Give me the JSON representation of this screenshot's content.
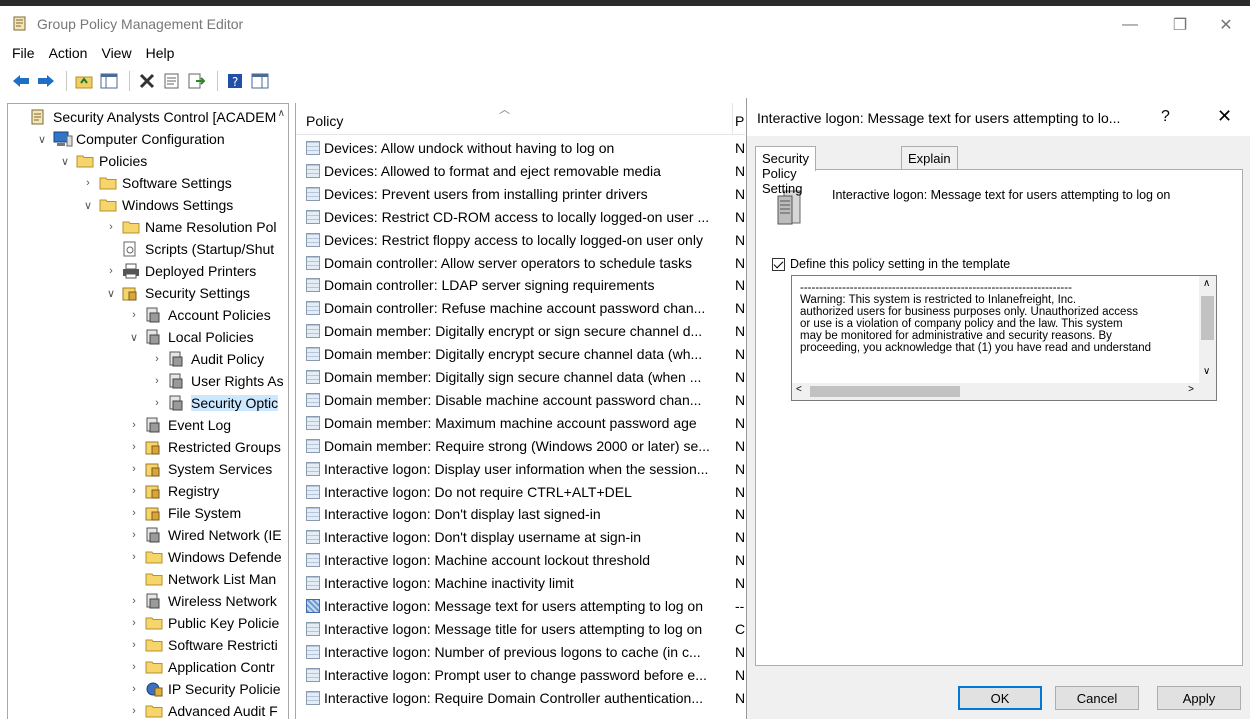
{
  "window": {
    "title": "Group Policy Management Editor"
  },
  "menu": [
    "File",
    "Action",
    "View",
    "Help"
  ],
  "tree": [
    {
      "label": "Security Analysts Control [ACADEM",
      "indent": 0,
      "chev": "",
      "icon": "gpo"
    },
    {
      "label": "Computer Configuration",
      "indent": 1,
      "chev": "v",
      "icon": "computer"
    },
    {
      "label": "Policies",
      "indent": 2,
      "chev": "v",
      "icon": "folder"
    },
    {
      "label": "Software Settings",
      "indent": 3,
      "chev": ">",
      "icon": "folder"
    },
    {
      "label": "Windows Settings",
      "indent": 3,
      "chev": "v",
      "icon": "folder"
    },
    {
      "label": "Name Resolution Pol",
      "indent": 4,
      "chev": ">",
      "icon": "folder"
    },
    {
      "label": "Scripts (Startup/Shut",
      "indent": 4,
      "chev": "",
      "icon": "script"
    },
    {
      "label": "Deployed Printers",
      "indent": 4,
      "chev": ">",
      "icon": "printer"
    },
    {
      "label": "Security Settings",
      "indent": 4,
      "chev": "v",
      "icon": "shield"
    },
    {
      "label": "Account Policies",
      "indent": 5,
      "chev": ">",
      "icon": "gear"
    },
    {
      "label": "Local Policies",
      "indent": 5,
      "chev": "v",
      "icon": "gear"
    },
    {
      "label": "Audit Policy",
      "indent": 6,
      "chev": ">",
      "icon": "gear"
    },
    {
      "label": "User Rights As",
      "indent": 6,
      "chev": ">",
      "icon": "gear"
    },
    {
      "label": "Security Optic",
      "indent": 6,
      "chev": ">",
      "icon": "gear",
      "selected": true
    },
    {
      "label": "Event Log",
      "indent": 5,
      "chev": ">",
      "icon": "gear"
    },
    {
      "label": "Restricted Groups",
      "indent": 5,
      "chev": ">",
      "icon": "shield"
    },
    {
      "label": "System Services",
      "indent": 5,
      "chev": ">",
      "icon": "shield"
    },
    {
      "label": "Registry",
      "indent": 5,
      "chev": ">",
      "icon": "shield"
    },
    {
      "label": "File System",
      "indent": 5,
      "chev": ">",
      "icon": "shield"
    },
    {
      "label": "Wired Network (IE",
      "indent": 5,
      "chev": ">",
      "icon": "gear"
    },
    {
      "label": "Windows Defende",
      "indent": 5,
      "chev": ">",
      "icon": "folder"
    },
    {
      "label": "Network List Man",
      "indent": 5,
      "chev": "",
      "icon": "folder"
    },
    {
      "label": "Wireless Network",
      "indent": 5,
      "chev": ">",
      "icon": "gear"
    },
    {
      "label": "Public Key Policie",
      "indent": 5,
      "chev": ">",
      "icon": "folder"
    },
    {
      "label": "Software Restricti",
      "indent": 5,
      "chev": ">",
      "icon": "folder"
    },
    {
      "label": "Application Contr",
      "indent": 5,
      "chev": ">",
      "icon": "folder"
    },
    {
      "label": "IP Security Policie",
      "indent": 5,
      "chev": ">",
      "icon": "ipsec"
    },
    {
      "label": "Advanced Audit F",
      "indent": 5,
      "chev": ">",
      "icon": "folder"
    }
  ],
  "list": {
    "header_policy": "Policy",
    "header_setting": "P",
    "rows": [
      {
        "name": "Devices: Allow undock without having to log on",
        "value": "N"
      },
      {
        "name": "Devices: Allowed to format and eject removable media",
        "value": "N"
      },
      {
        "name": "Devices: Prevent users from installing printer drivers",
        "value": "N"
      },
      {
        "name": "Devices: Restrict CD-ROM access to locally logged-on user ...",
        "value": "N"
      },
      {
        "name": "Devices: Restrict floppy access to locally logged-on user only",
        "value": "N"
      },
      {
        "name": "Domain controller: Allow server operators to schedule tasks",
        "value": "N"
      },
      {
        "name": "Domain controller: LDAP server signing requirements",
        "value": "N"
      },
      {
        "name": "Domain controller: Refuse machine account password chan...",
        "value": "N"
      },
      {
        "name": "Domain member: Digitally encrypt or sign secure channel d...",
        "value": "N"
      },
      {
        "name": "Domain member: Digitally encrypt secure channel data (wh...",
        "value": "N"
      },
      {
        "name": "Domain member: Digitally sign secure channel data (when ...",
        "value": "N"
      },
      {
        "name": "Domain member: Disable machine account password chan...",
        "value": "N"
      },
      {
        "name": "Domain member: Maximum machine account password age",
        "value": "N"
      },
      {
        "name": "Domain member: Require strong (Windows 2000 or later) se...",
        "value": "N"
      },
      {
        "name": "Interactive logon: Display user information when the session...",
        "value": "N"
      },
      {
        "name": "Interactive logon: Do not require CTRL+ALT+DEL",
        "value": "N"
      },
      {
        "name": "Interactive logon: Don't display last signed-in",
        "value": "N"
      },
      {
        "name": "Interactive logon: Don't display username at sign-in",
        "value": "N"
      },
      {
        "name": "Interactive logon: Machine account lockout threshold",
        "value": "N"
      },
      {
        "name": "Interactive logon: Machine inactivity limit",
        "value": "N"
      },
      {
        "name": "Interactive logon: Message text for users attempting to log on",
        "value": "--",
        "highlight": true
      },
      {
        "name": "Interactive logon: Message title for users attempting to log on",
        "value": "C"
      },
      {
        "name": "Interactive logon: Number of previous logons to cache (in c...",
        "value": "N"
      },
      {
        "name": "Interactive logon: Prompt user to change password before e...",
        "value": "N"
      },
      {
        "name": "Interactive logon: Require Domain Controller authentication...",
        "value": "N"
      }
    ]
  },
  "dialog": {
    "title": "Interactive logon: Message text for users attempting to lo...",
    "help": "?",
    "close": "✕",
    "tab_setting": "Security Policy Setting",
    "tab_explain": "Explain",
    "policy_title": "Interactive logon: Message text for users attempting to log on",
    "define_label": "Define this policy setting in the template",
    "message": "-----------------------------------------------------------------------\nWarning: This system is restricted to Inlanefreight, Inc.\nauthorized users for business purposes only. Unauthorized access\nor use is a violation of company policy and the law. This system\nmay be monitored for administrative and security reasons. By\nproceeding, you acknowledge that (1) you have read and understand",
    "ok": "OK",
    "cancel": "Cancel",
    "apply": "Apply"
  },
  "colors": {
    "accent": "#0078d7",
    "selection": "#cce8ff"
  }
}
